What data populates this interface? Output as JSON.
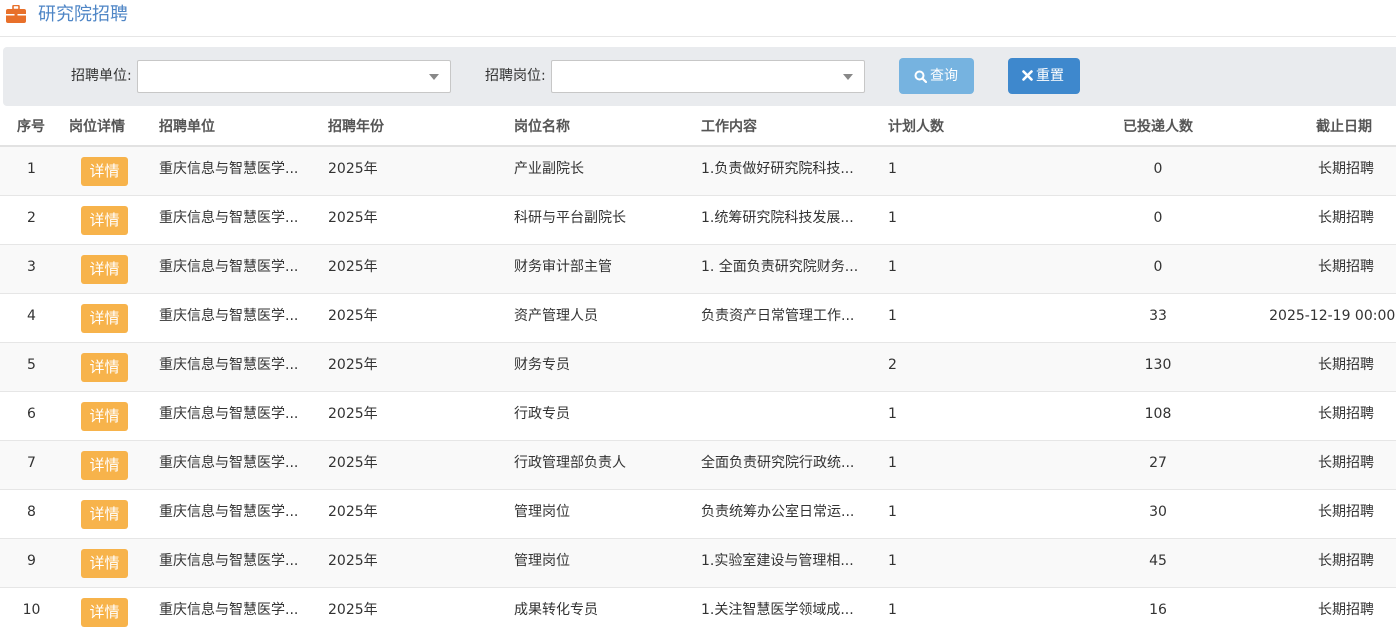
{
  "header": {
    "title": "研究院招聘"
  },
  "filters": {
    "unit_label": "招聘单位:",
    "unit_value": "",
    "position_label": "招聘岗位:",
    "position_value": "",
    "query_label": "查询",
    "reset_label": "重置"
  },
  "table": {
    "columns": [
      "序号",
      "岗位详情",
      "招聘单位",
      "招聘年份",
      "岗位名称",
      "工作内容",
      "计划人数",
      "已投递人数",
      "截止日期"
    ],
    "detail_label": "详情",
    "rows": [
      {
        "seq": "1",
        "unit": "重庆信息与智慧医学...",
        "year": "2025年",
        "position": "产业副院长",
        "content": "1.负责做好研究院科技...",
        "plan": "1",
        "applied": "0",
        "deadline": "长期招聘"
      },
      {
        "seq": "2",
        "unit": "重庆信息与智慧医学...",
        "year": "2025年",
        "position": "科研与平台副院长",
        "content": "1.统筹研究院科技发展...",
        "plan": "1",
        "applied": "0",
        "deadline": "长期招聘"
      },
      {
        "seq": "3",
        "unit": "重庆信息与智慧医学...",
        "year": "2025年",
        "position": "财务审计部主管",
        "content": "1. 全面负责研究院财务...",
        "plan": "1",
        "applied": "0",
        "deadline": "长期招聘"
      },
      {
        "seq": "4",
        "unit": "重庆信息与智慧医学...",
        "year": "2025年",
        "position": "资产管理人员",
        "content": "负责资产日常管理工作...",
        "plan": "1",
        "applied": "33",
        "deadline": "2025-12-19 00:00:"
      },
      {
        "seq": "5",
        "unit": "重庆信息与智慧医学...",
        "year": "2025年",
        "position": "财务专员",
        "content": "",
        "plan": "2",
        "applied": "130",
        "deadline": "长期招聘"
      },
      {
        "seq": "6",
        "unit": "重庆信息与智慧医学...",
        "year": "2025年",
        "position": "行政专员",
        "content": "",
        "plan": "1",
        "applied": "108",
        "deadline": "长期招聘"
      },
      {
        "seq": "7",
        "unit": "重庆信息与智慧医学...",
        "year": "2025年",
        "position": "行政管理部负责人",
        "content": "全面负责研究院行政统...",
        "plan": "1",
        "applied": "27",
        "deadline": "长期招聘"
      },
      {
        "seq": "8",
        "unit": "重庆信息与智慧医学...",
        "year": "2025年",
        "position": "管理岗位",
        "content": "负责统筹办公室日常运...",
        "plan": "1",
        "applied": "30",
        "deadline": "长期招聘"
      },
      {
        "seq": "9",
        "unit": "重庆信息与智慧医学...",
        "year": "2025年",
        "position": "管理岗位",
        "content": "1.实验室建设与管理相...",
        "plan": "1",
        "applied": "45",
        "deadline": "长期招聘"
      },
      {
        "seq": "10",
        "unit": "重庆信息与智慧医学...",
        "year": "2025年",
        "position": "成果转化专员",
        "content": "1.关注智慧医学领域成...",
        "plan": "1",
        "applied": "16",
        "deadline": "长期招聘"
      }
    ]
  },
  "colors": {
    "title": "#4f86c6",
    "icon": "#e8702a",
    "detail_button": "#f7b34b",
    "query_button": "#76b3e0",
    "reset_button": "#3e88cd"
  },
  "icons": {
    "header": "briefcase-icon",
    "query": "search-icon",
    "reset": "close-icon",
    "select": "chevron-down-icon"
  }
}
